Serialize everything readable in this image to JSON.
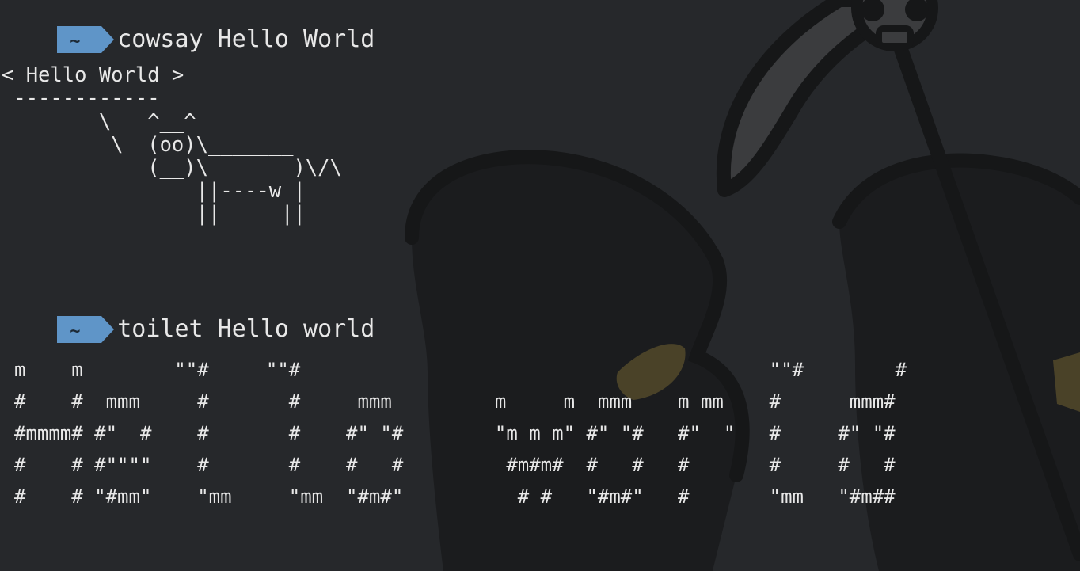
{
  "terminal": {
    "prompt_symbol": "~",
    "commands": [
      {
        "command": "cowsay Hello World",
        "output": " ____________\n< Hello World >\n ------------\n        \\   ^__^\n         \\  (oo)\\_______\n            (__)\\       )\\/\\\n                ||----w |\n                ||     ||"
      },
      {
        "command": "toilet Hello world",
        "output": "m    m        \"\"#     \"\"#                                         \"\"#        #\n#    #  mmm     #       #     mmm         m     m  mmm    m mm    #      mmm#\n#mmmm# #\"  #    #       #    #\" \"#        \"m m m\" #\" \"#   #\"  \"   #     #\" \"#\n#    # #\"\"\"\"    #       #    #   #         #m#m#  #   #   #       #     #   #\n#    # \"#mm\"    \"mm     \"mm  \"#m#\"          # #   \"#m#\"   #       \"mm   \"#m##"
      }
    ]
  },
  "colors": {
    "background": "#26282b",
    "prompt_badge": "#5f95c8",
    "text": "#e8e8e8"
  },
  "icons": {
    "wallpaper": "grim-reaper-silhouette"
  }
}
